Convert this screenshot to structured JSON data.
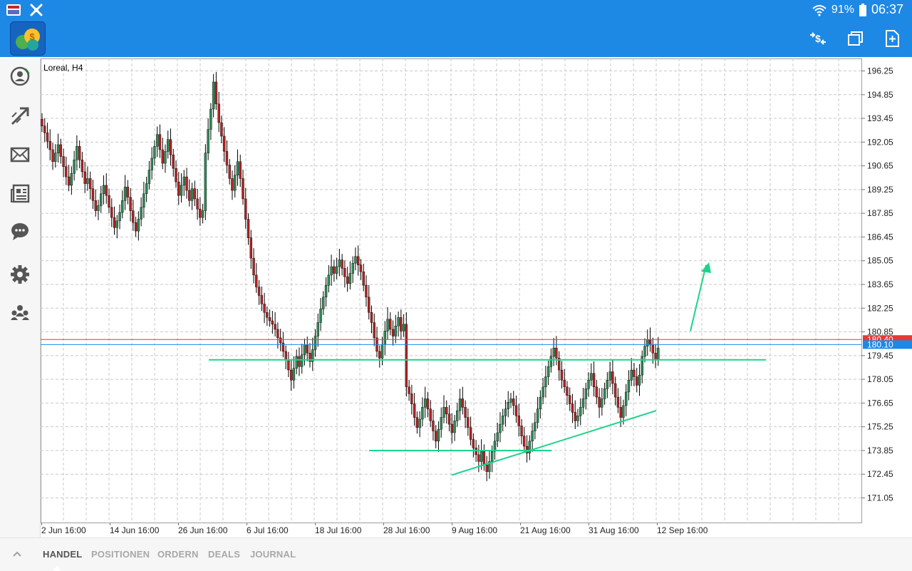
{
  "status_bar": {
    "battery": "91%",
    "time": "06:37",
    "icons": [
      "app-thumbnail-icon",
      "settings-gear-icon",
      "wifi-icon",
      "battery-icon"
    ]
  },
  "app_bar": {
    "logo": "metatrader-logo",
    "actions": [
      "one-click-trading-icon",
      "windows-icon",
      "new-order-icon"
    ]
  },
  "sidebar": {
    "items": [
      "account-icon",
      "trade-icon",
      "mail-icon",
      "news-icon",
      "chat-icon",
      "settings-icon",
      "community-icon"
    ]
  },
  "chart": {
    "title": "Loreal, H4",
    "bid_label": "180.40",
    "ask_label": "180.10",
    "colors": {
      "up": "#2e8b57",
      "down": "#b22222",
      "grid": "#c8c8c8",
      "bid_line": "#e53935",
      "ask_line": "#1e88e5",
      "drawing": "#1dd38a"
    }
  },
  "chart_data": {
    "type": "candlestick",
    "symbol": "Loreal",
    "timeframe": "H4",
    "y_ticks": [
      "196.25",
      "194.85",
      "193.45",
      "192.05",
      "190.65",
      "189.25",
      "187.85",
      "186.45",
      "185.05",
      "183.65",
      "182.25",
      "180.85",
      "179.45",
      "178.05",
      "176.65",
      "175.25",
      "173.85",
      "172.45",
      "171.05"
    ],
    "x_ticks": [
      "2 Jun 16:00",
      "14 Jun 16:00",
      "26 Jun 16:00",
      "6 Jul 16:00",
      "18 Jul 16:00",
      "28 Jul 16:00",
      "9 Aug 16:00",
      "21 Aug 16:00",
      "31 Aug 16:00",
      "12 Sep 16:00"
    ],
    "ylim": [
      170.0,
      196.8
    ],
    "bid": 180.4,
    "ask": 180.1,
    "grid": true,
    "closes": [
      193.0,
      192.6,
      192.1,
      191.6,
      190.9,
      191.4,
      191.9,
      191.2,
      190.6,
      190.0,
      189.5,
      190.2,
      191.0,
      191.8,
      191.0,
      190.3,
      189.6,
      189.9,
      189.3,
      188.6,
      188.0,
      188.3,
      189.0,
      189.5,
      188.9,
      188.2,
      187.6,
      187.0,
      187.4,
      187.9,
      188.6,
      189.4,
      188.8,
      188.0,
      187.3,
      186.8,
      187.5,
      188.2,
      189.0,
      189.6,
      190.4,
      191.1,
      191.8,
      192.5,
      191.6,
      190.8,
      191.5,
      192.2,
      191.3,
      190.5,
      189.7,
      188.9,
      189.5,
      190.0,
      189.2,
      188.6,
      189.3,
      188.7,
      188.1,
      187.6,
      188.0,
      191.4,
      192.8,
      194.0,
      195.6,
      194.3,
      193.2,
      192.4,
      191.5,
      190.7,
      189.9,
      189.2,
      190.1,
      190.9,
      189.9,
      188.7,
      187.5,
      186.4,
      185.2,
      184.2,
      183.5,
      183.0,
      182.5,
      182.0,
      181.7,
      181.5,
      181.3,
      181.0,
      180.5,
      180.2,
      179.7,
      179.2,
      178.6,
      178.0,
      178.7,
      179.4,
      178.8,
      179.5,
      180.1,
      179.6,
      179.1,
      179.8,
      180.6,
      181.4,
      182.2,
      182.9,
      183.6,
      184.2,
      184.7,
      184.3,
      184.7,
      185.1,
      184.6,
      184.1,
      183.7,
      184.3,
      184.9,
      185.3,
      184.8,
      184.4,
      183.6,
      182.9,
      182.0,
      181.4,
      180.5,
      179.7,
      179.3,
      180.1,
      180.9,
      181.6,
      181.0,
      180.6,
      181.2,
      181.7,
      180.9,
      181.3,
      177.6,
      177.2,
      176.6,
      175.8,
      175.2,
      175.7,
      176.4,
      176.9,
      176.3,
      175.6,
      175.0,
      174.4,
      175.1,
      175.8,
      176.4,
      176.0,
      175.4,
      174.9,
      175.6,
      176.2,
      176.9,
      176.4,
      175.8,
      175.2,
      174.5,
      174.0,
      173.6,
      173.2,
      173.8,
      173.0,
      172.6,
      173.2,
      173.8,
      174.4,
      174.9,
      175.4,
      175.9,
      176.3,
      176.7,
      176.9,
      176.5,
      175.9,
      175.3,
      174.7,
      174.1,
      173.7,
      174.4,
      175.0,
      175.5,
      176.3,
      177.0,
      177.6,
      178.2,
      178.8,
      179.4,
      179.9,
      179.3,
      178.6,
      178.0,
      177.6,
      177.1,
      176.6,
      176.1,
      175.6,
      175.9,
      176.4,
      176.9,
      177.5,
      178.0,
      178.4,
      177.6,
      177.0,
      176.4,
      176.9,
      177.5,
      178.0,
      178.5,
      177.8,
      177.0,
      176.4,
      175.8,
      176.5,
      177.3,
      178.0,
      178.6,
      178.2,
      177.7,
      178.3,
      179.4,
      180.0,
      180.4,
      180.1,
      179.6,
      179.2,
      179.9
    ]
  },
  "bottom_tabs": [
    "HANDEL",
    "POSITIONEN",
    "ORDERN",
    "DEALS",
    "JOURNAL"
  ],
  "active_tab": "HANDEL"
}
